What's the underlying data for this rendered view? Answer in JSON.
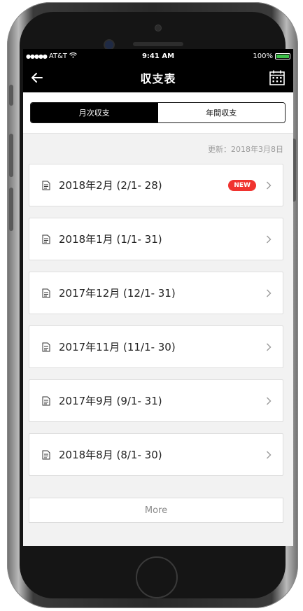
{
  "status_bar": {
    "carrier": "AT&T",
    "time": "9:41 AM",
    "battery": "100%"
  },
  "nav": {
    "title": "収支表",
    "back_icon": "arrow-left-icon",
    "calendar_icon": "calendar-icon"
  },
  "tabs": [
    {
      "label": "月次収支",
      "active": true
    },
    {
      "label": "年間収支",
      "active": false
    }
  ],
  "updated": "更新：2018年3月8日",
  "periods": [
    {
      "label": "2018年2月 (2/1- 28)",
      "badge": "NEW"
    },
    {
      "label": "2018年1月 (1/1- 31)"
    },
    {
      "label": "2017年12月 (12/1- 31)"
    },
    {
      "label": "2017年11月 (11/1- 30)"
    },
    {
      "label": "2017年9月 (9/1- 31)"
    },
    {
      "label": "2018年8月 (8/1- 30)"
    }
  ],
  "more_label": "More",
  "colors": {
    "badge": "#f0332f",
    "battery": "#3ec04a",
    "nav_background": "#000000"
  }
}
